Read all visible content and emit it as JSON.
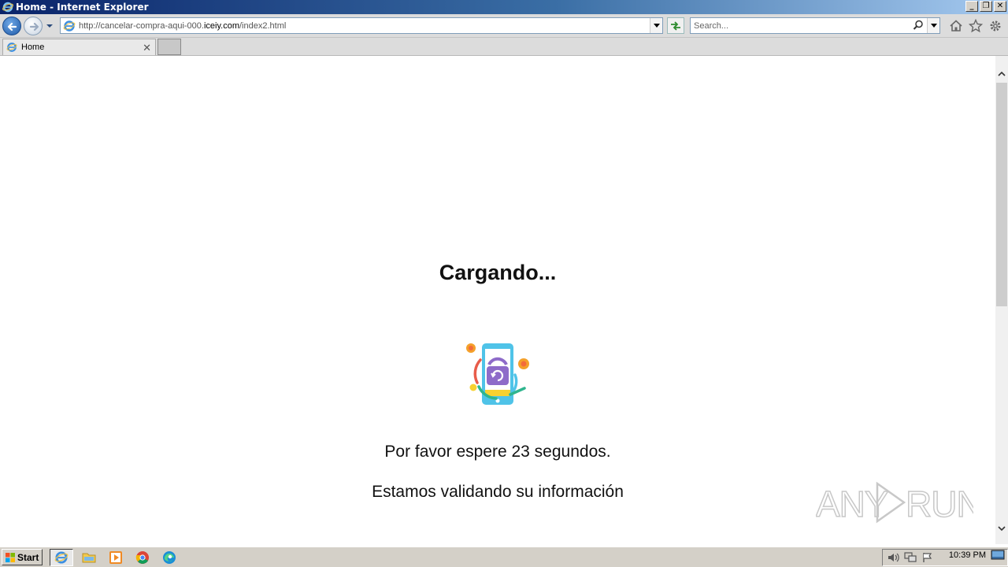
{
  "window": {
    "title": "Home - Internet Explorer",
    "controls": [
      "_",
      "❐",
      "✕"
    ]
  },
  "navbar": {
    "url_prefix": "http://cancelar-compra-aqui-000.",
    "url_domain": "iceiy.com",
    "url_suffix": "/index2.html",
    "search_placeholder": "Search..."
  },
  "tabs": [
    {
      "label": "Home"
    }
  ],
  "page": {
    "heading": "Cargando...",
    "wait_message": "Por favor espere 23 segundos.",
    "validation_message": "Estamos validando su información"
  },
  "watermark": {
    "text": "ANY RUN"
  },
  "taskbar": {
    "start_label": "Start",
    "pinned": [
      "internet-explorer-icon",
      "file-explorer-icon",
      "media-player-icon",
      "chrome-icon",
      "edge-icon"
    ],
    "clock": "10:39 PM"
  },
  "colors": {
    "title_gradient_start": "#0a246a",
    "title_gradient_end": "#a6caf0",
    "phone_blue": "#4fc3e8",
    "lock_purple": "#8e6bc9",
    "dot_orange": "#f4a02a"
  }
}
